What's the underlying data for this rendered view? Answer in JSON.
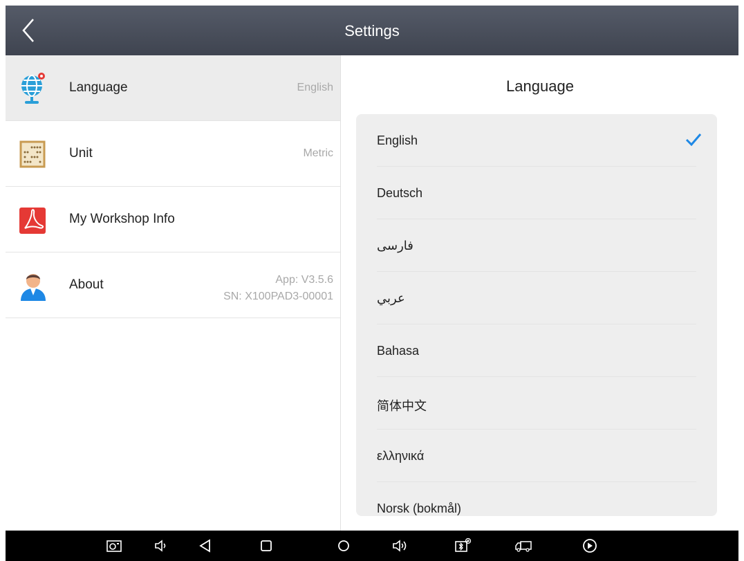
{
  "header": {
    "title": "Settings"
  },
  "settings_menu": [
    {
      "label": "Language",
      "value": "English",
      "icon": "globe-pin-icon"
    },
    {
      "label": "Unit",
      "value": "Metric",
      "icon": "abacus-icon"
    },
    {
      "label": "My Workshop Info",
      "value": "",
      "icon": "pdf-icon"
    },
    {
      "label": "About",
      "value_line1": "App: V3.5.6",
      "value_line2": "SN: X100PAD3-00001",
      "icon": "user-icon"
    }
  ],
  "language_panel": {
    "title": "Language",
    "selected": "English",
    "options": [
      "English",
      "Deutsch",
      "فارسی",
      "عربي",
      "Bahasa",
      "简体中文",
      "ελληνικά",
      "Norsk (bokmål)"
    ]
  },
  "nav_bar": {
    "icons": [
      "screenshot-icon",
      "volume-down-icon",
      "back-icon",
      "recent-apps-icon",
      "home-icon",
      "volume-up-icon",
      "vci-icon",
      "truck-icon",
      "play-icon"
    ]
  },
  "colors": {
    "titlebar": "#4a4f5b",
    "selected_row": "#ececec",
    "accent_check": "#1e88e5",
    "card_bg": "#eeeeee"
  }
}
